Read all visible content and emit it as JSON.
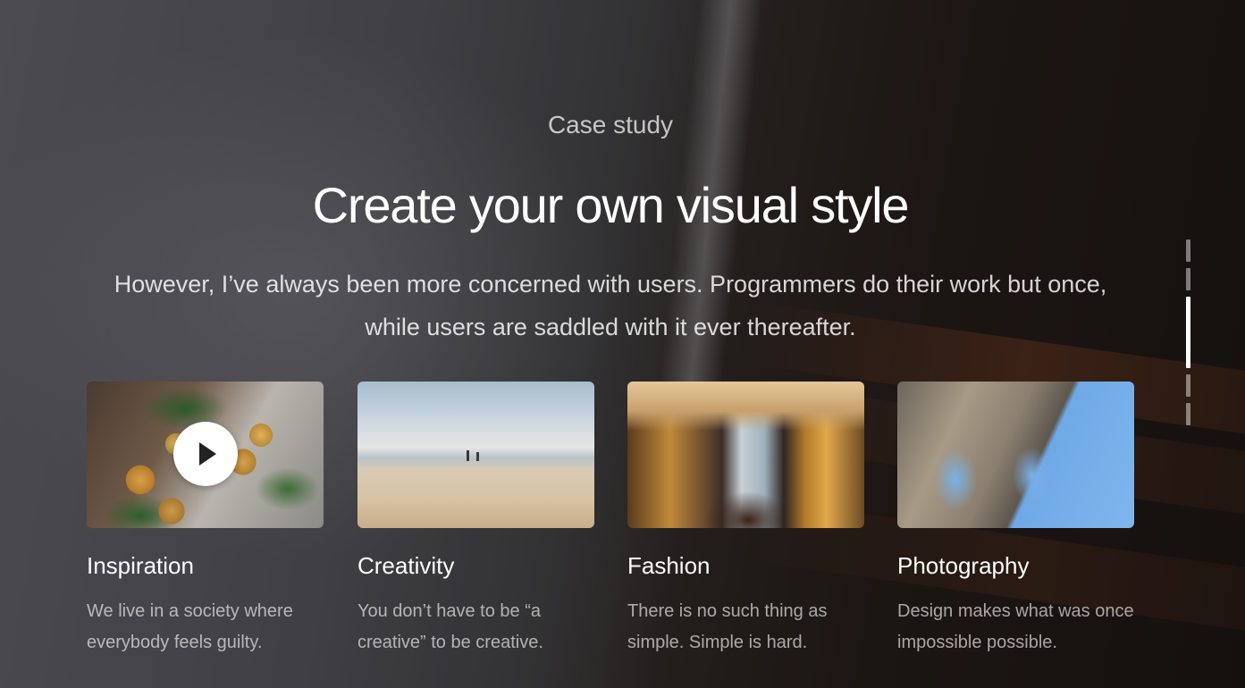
{
  "section": {
    "eyebrow": "Case study",
    "headline": "Create your own visual style",
    "lead": "However, I’ve always been more concerned with users. Programmers do their work but once, while users are saddled with it ever thereafter."
  },
  "cards": [
    {
      "title": "Inspiration",
      "text": "We live in a society where everybody feels guilty.",
      "has_play": true
    },
    {
      "title": "Creativity",
      "text": "You don’t have to be “a creative” to be creative."
    },
    {
      "title": "Fashion",
      "text": "There is no such thing as simple. Simple is hard."
    },
    {
      "title": "Photography",
      "text": "Design makes what was once impossible possible."
    }
  ],
  "scroll_indicator": {
    "count": 5,
    "active_index": 2
  },
  "colors": {
    "text": "#ffffff",
    "muted_text": "rgba(255,255,255,0.62)",
    "play_button": "#ffffff"
  }
}
